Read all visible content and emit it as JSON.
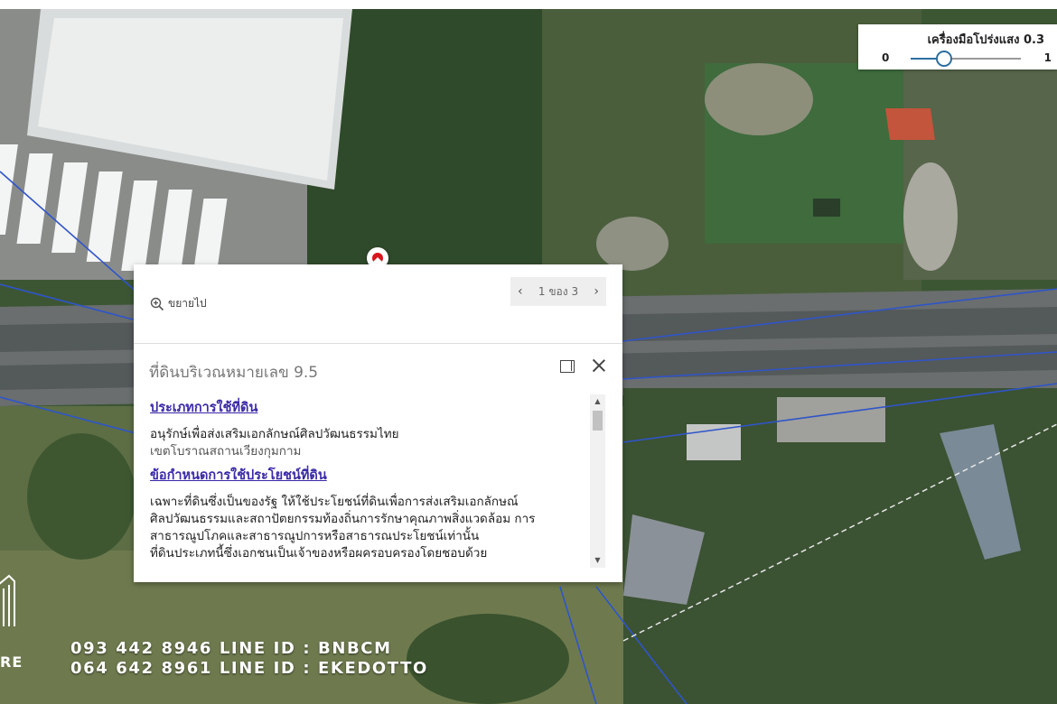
{
  "slider": {
    "title": "เครื่องมือโปร่งแสง 0.3",
    "min_label": "0",
    "max_label": "1",
    "value": 0.3,
    "accent": "#2b6f9e"
  },
  "marker": {
    "color": "#d9141b",
    "icon": "map-pin-icon"
  },
  "popup": {
    "zoom_label": "ขยายไป",
    "pager_text": "1 ของ 3",
    "title": "ที่ดินบริเวณหมายเลข 9.5",
    "sections": [
      {
        "heading": "ประเภทการใช้ที่ดิน",
        "lines": [
          "อนุรักษ์เพื่อส่งเสริมเอกลักษณ์ศิลปวัฒนธรรมไทย"
        ],
        "sub": "เขตโบราณสถานเวียงกุมกาม"
      },
      {
        "heading": "ข้อกำหนดการใช้ประโยชน์ที่ดิน",
        "lines": [
          "เฉพาะที่ดินซึ่งเป็นของรัฐ ให้ใช้ประโยชน์ที่ดินเพื่อการส่งเสริมเอกลักษณ์",
          "ศิลปวัฒนธรรมและสถาปัตยกรรมท้องถิ่นการรักษาคุณภาพสิ่งแวดล้อม การ",
          "สาธารณูปโภคและสาธารณูปการหรือสาธารณประโยชน์เท่านั้น",
          "ที่ดินประเภทนี้ซึ่งเอกชนเป็นเจ้าของหรือผครอบครองโดยชอบด้วย"
        ]
      }
    ],
    "link_color": "#3a2aa8"
  },
  "watermark": {
    "line1": "093 442 8946 LINE ID : BNBCM",
    "line2": "064 642 8961  LINE ID : EKEDOTTO",
    "logo_text": "RE"
  }
}
